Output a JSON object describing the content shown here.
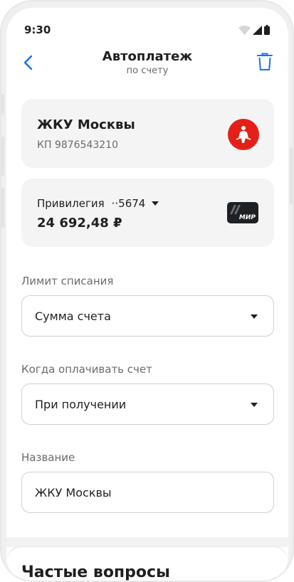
{
  "status_bar": {
    "time": "9:30"
  },
  "header": {
    "title": "Автоплатеж",
    "subtitle": "по счету"
  },
  "provider": {
    "name": "ЖКУ Москвы",
    "account": "КП 9876543210"
  },
  "payment_account": {
    "name": "Привилегия",
    "separator": "··",
    "last4": "5674",
    "balance": "24 692,48 ₽",
    "card_brand": "МИР"
  },
  "fields": [
    {
      "label": "Лимит списания",
      "value": "Сумма счета"
    },
    {
      "label": "Когда оплачивать счет",
      "value": "При получении"
    },
    {
      "label": "Название",
      "value": "ЖКУ Москвы"
    }
  ],
  "faq": {
    "title": "Частые вопросы"
  },
  "colors": {
    "accent": "#1a73e8",
    "emblem": "#e32119",
    "card_bg": "#f4f4f4",
    "text": "#1f1f1f",
    "muted": "#6b6b6b"
  }
}
